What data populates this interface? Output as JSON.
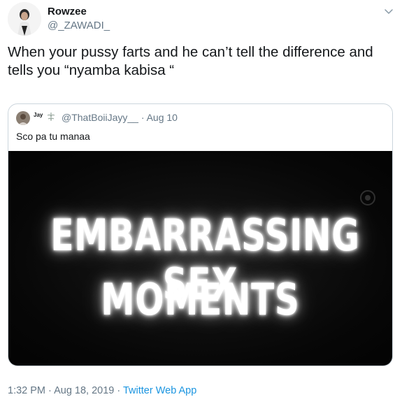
{
  "tweet": {
    "display_name": "Rowzee",
    "handle": "@_ZAWADI_",
    "text": "When your pussy farts and he can’t tell the difference and tells you “nyamba kabisa “"
  },
  "quoted_tweet": {
    "display_name": "Jay",
    "handle_and_date": "@ThatBoiiJayy__ · Aug 10",
    "text": "Sco pa tu manaa",
    "media": {
      "line1": "EMBARRASSING SEX",
      "line2": "MOMENTS"
    }
  },
  "footer": {
    "timestamp": "1:32 PM · Aug 18, 2019 · ",
    "source": "Twitter Web App"
  },
  "icons": {
    "caret": "chevron-down-icon",
    "badge": "leaf-emoji-icon"
  },
  "colors": {
    "text_primary": "#14171a",
    "text_secondary": "#657786",
    "link": "#1b95e0",
    "border": "#ccd6dd"
  }
}
